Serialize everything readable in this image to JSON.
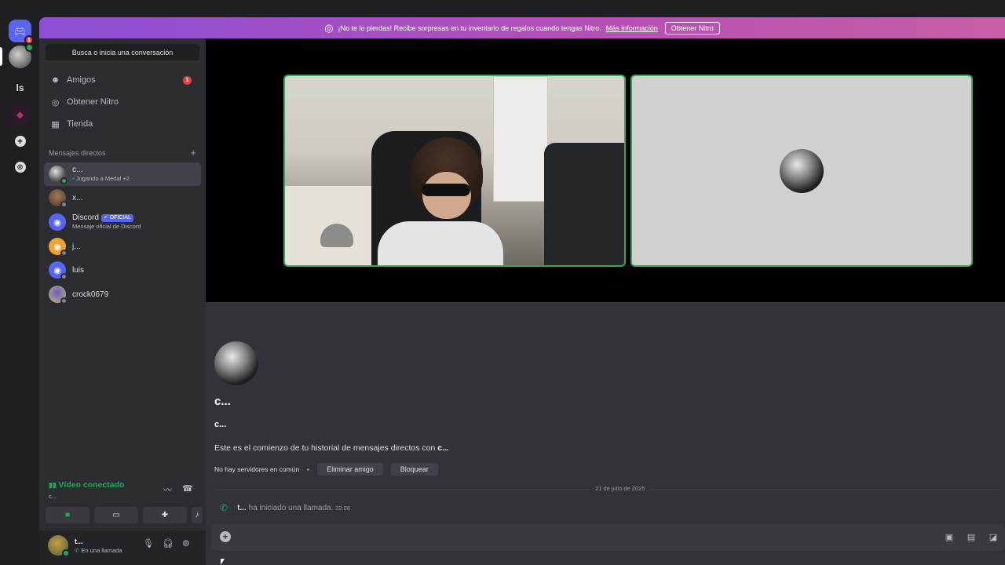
{
  "rail": {
    "discord_badge": "1",
    "ls_label": "ls",
    "add_icon": "+",
    "explore_icon": "compass"
  },
  "banner": {
    "text": "¡No te lo pierdas! Recibe sorpresas en tu inventario de regalos cuando tengas Nitro.",
    "link": "Más información",
    "button": "Obtener Nitro"
  },
  "sidebar": {
    "search_placeholder": "Busca o inicia una conversación",
    "nav": [
      {
        "label": "Amigos",
        "icon": "friends-icon",
        "badge": "1"
      },
      {
        "label": "Obtener Nitro",
        "icon": "nitro-icon"
      },
      {
        "label": "Tienda",
        "icon": "shop-icon"
      }
    ],
    "dm_header": "Mensajes directos",
    "dm_add": "+",
    "dms": [
      {
        "name": "c...",
        "sub": "Jugando a Medal +2",
        "status": "online"
      },
      {
        "name": "x...",
        "sub": "",
        "status": "offline"
      },
      {
        "name": "Discord",
        "badge": "✓ OFICIAL",
        "sub": "Mensaje oficial de Discord",
        "status": ""
      },
      {
        "name": "j...",
        "sub": "",
        "status": "offline"
      },
      {
        "name": "luis",
        "sub": "",
        "status": "offline"
      },
      {
        "name": "crock0679",
        "sub": "",
        "status": "offline"
      }
    ]
  },
  "voice": {
    "title": "Vídeo conectado",
    "channel": "c..."
  },
  "user": {
    "name": "t...",
    "status": "En una llamada"
  },
  "chat": {
    "profile_name_big": "c...",
    "profile_name_small": "c...",
    "intro_prefix": "Este es el comienzo de tu historial de mensajes directos con ",
    "intro_name": "c...",
    "no_servers": "No hay servidores en común",
    "remove_friend": "Eliminar amigo",
    "block": "Bloquear",
    "date": "21 de julio de 2025",
    "call_user": "t...",
    "call_text": " ha iniciado una llamada.",
    "call_time": "22:08"
  },
  "colors": {
    "accent": "#5865f2",
    "online": "#23a55a",
    "danger": "#f23f43",
    "tile_border": "#3ba55c"
  }
}
